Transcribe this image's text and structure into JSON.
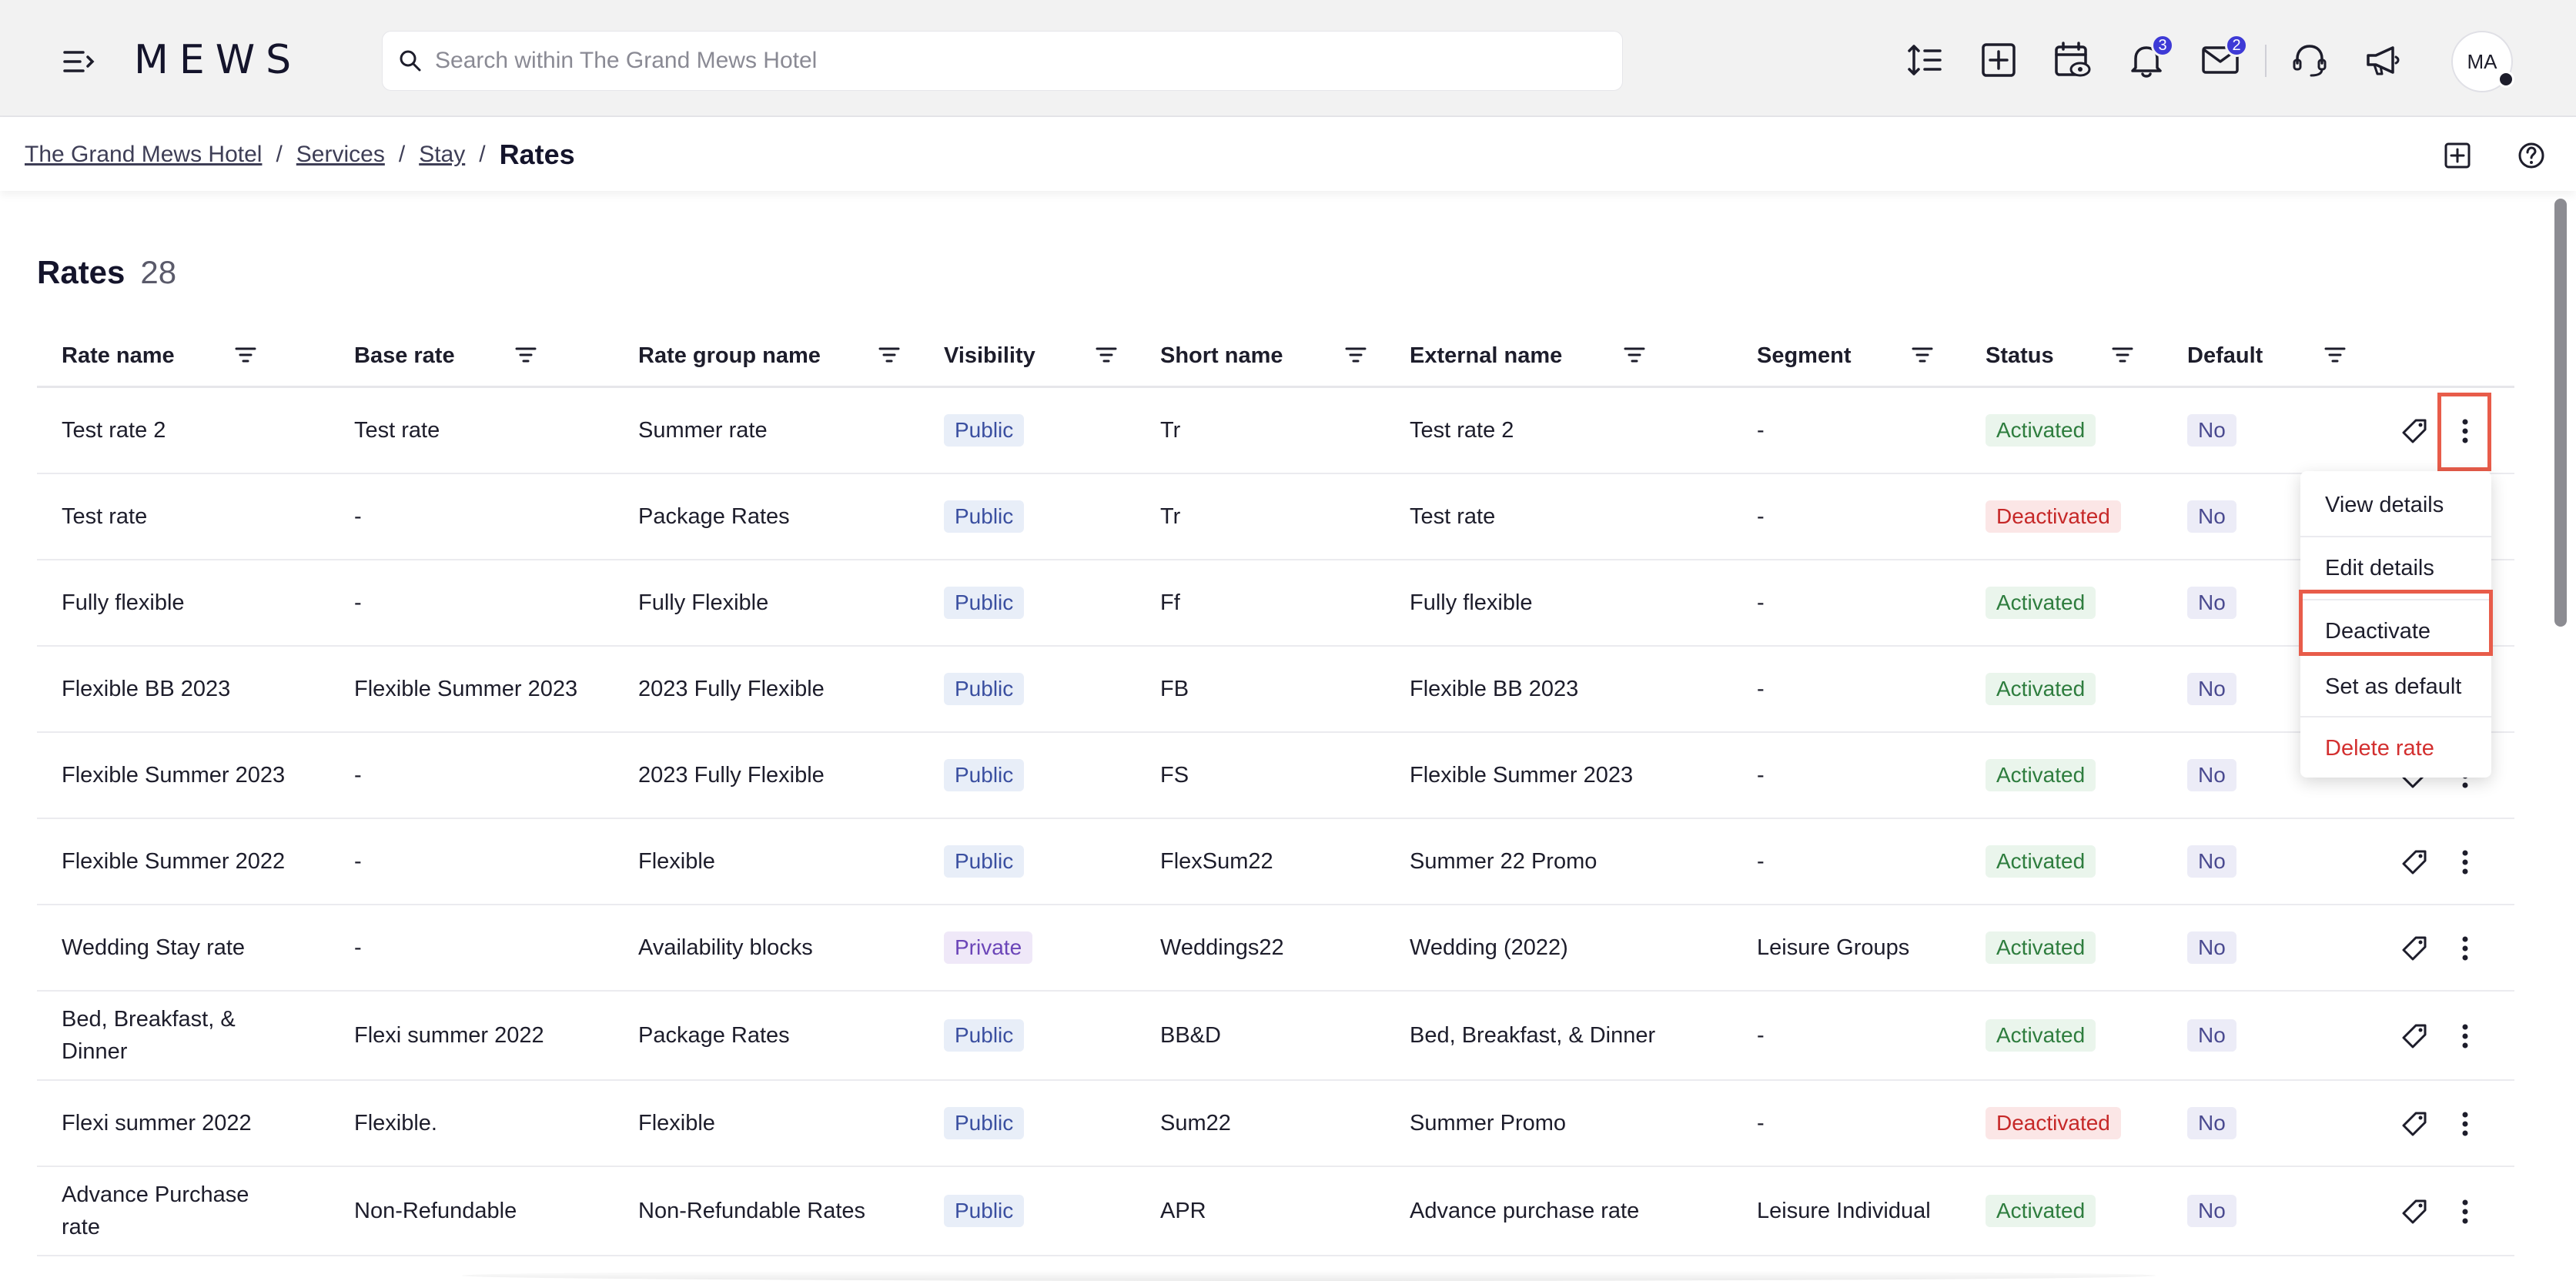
{
  "topbar": {
    "logo": "MEWS",
    "search_placeholder": "Search within The Grand Mews Hotel",
    "notifications_count": "3",
    "messages_count": "2",
    "avatar_initials": "MA"
  },
  "breadcrumb": {
    "items": [
      "The Grand Mews Hotel",
      "Services",
      "Stay"
    ],
    "separator": "/",
    "current": "Rates"
  },
  "page": {
    "title": "Rates",
    "count": "28"
  },
  "table": {
    "columns": [
      "Rate name",
      "Base rate",
      "Rate group name",
      "Visibility",
      "Short name",
      "External name",
      "Segment",
      "Status",
      "Default"
    ],
    "rows": [
      {
        "rate_name": "Test rate 2",
        "base_rate": "Test rate",
        "group": "Summer rate",
        "visibility": "Public",
        "short": "Tr",
        "external": "Test rate 2",
        "segment": "-",
        "status": "Activated",
        "default": "No"
      },
      {
        "rate_name": "Test rate",
        "base_rate": "-",
        "group": "Package Rates",
        "visibility": "Public",
        "short": "Tr",
        "external": "Test rate",
        "segment": "-",
        "status": "Deactivated",
        "default": "No"
      },
      {
        "rate_name": "Fully flexible",
        "base_rate": "-",
        "group": "Fully Flexible",
        "visibility": "Public",
        "short": "Ff",
        "external": "Fully flexible",
        "segment": "-",
        "status": "Activated",
        "default": "No"
      },
      {
        "rate_name": "Flexible BB 2023",
        "base_rate": "Flexible Summer 2023",
        "group": "2023 Fully Flexible",
        "visibility": "Public",
        "short": "FB",
        "external": "Flexible BB 2023",
        "segment": "-",
        "status": "Activated",
        "default": "No"
      },
      {
        "rate_name": "Flexible Summer 2023",
        "base_rate": "-",
        "group": "2023 Fully Flexible",
        "visibility": "Public",
        "short": "FS",
        "external": "Flexible Summer 2023",
        "segment": "-",
        "status": "Activated",
        "default": "No"
      },
      {
        "rate_name": "Flexible Summer 2022",
        "base_rate": "-",
        "group": "Flexible",
        "visibility": "Public",
        "short": "FlexSum22",
        "external": "Summer 22 Promo",
        "segment": "-",
        "status": "Activated",
        "default": "No"
      },
      {
        "rate_name": "Wedding Stay rate",
        "base_rate": "-",
        "group": "Availability blocks",
        "visibility": "Private",
        "short": "Weddings22",
        "external": "Wedding (2022)",
        "segment": "Leisure Groups",
        "status": "Activated",
        "default": "No"
      },
      {
        "rate_name": "Bed, Breakfast, & Dinner",
        "base_rate": "Flexi summer 2022",
        "group": "Package Rates",
        "visibility": "Public",
        "short": "BB&D",
        "external": "Bed, Breakfast, & Dinner",
        "segment": "-",
        "status": "Activated",
        "default": "No"
      },
      {
        "rate_name": "Flexi summer 2022",
        "base_rate": "Flexible.",
        "group": "Flexible",
        "visibility": "Public",
        "short": "Sum22",
        "external": "Summer Promo",
        "segment": "-",
        "status": "Deactivated",
        "default": "No"
      },
      {
        "rate_name": "Advance Purchase rate",
        "base_rate": "Non-Refundable",
        "group": "Non-Refundable Rates",
        "visibility": "Public",
        "short": "APR",
        "external": "Advance purchase rate",
        "segment": "Leisure Individual",
        "status": "Activated",
        "default": "No"
      }
    ]
  },
  "dropdown": {
    "items": [
      "View details",
      "Edit details",
      "Deactivate",
      "Set as default",
      "Delete rate"
    ]
  },
  "colors": {
    "highlight": "#e85c4a",
    "badge": "#3e3ad6",
    "activated": "#2e7d3e",
    "deactivated": "#c62828"
  }
}
